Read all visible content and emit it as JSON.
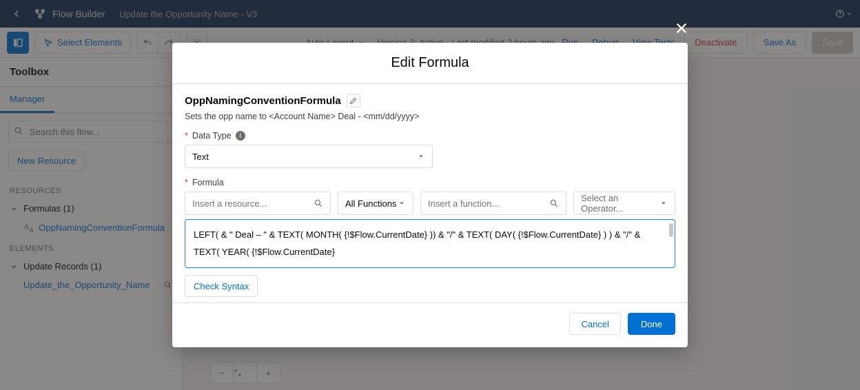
{
  "topbar": {
    "app_title": "Flow Builder",
    "page_name": "Update the Opportunity Name - V3"
  },
  "toolbar": {
    "select_elements": "Select Elements",
    "auto_layout": "Auto-Layout",
    "version_status": "Version 3: Active · Last modified 2 hours ago",
    "run": "Run",
    "debug": "Debug",
    "view_tests": "View Tests",
    "deactivate": "Deactivate",
    "save_as": "Save As",
    "save": "Save"
  },
  "sidebar": {
    "title": "Toolbox",
    "tab_manager": "Manager",
    "search_placeholder": "Search this flow...",
    "new_resource": "New Resource",
    "section_resources": "RESOURCES",
    "group_formulas": "Formulas (1)",
    "formula_item": "OppNamingConventionFormula",
    "section_elements": "ELEMENTS",
    "group_update_records": "Update Records (1)",
    "update_item": "Update_the_Opportunity_Name"
  },
  "modal": {
    "title": "Edit Formula",
    "formula_name": "OppNamingConventionFormula",
    "subtitle": "Sets the opp name to <Account Name> Deal - <mm/dd/yyyy>",
    "data_type_label": "Data Type",
    "data_type_value": "Text",
    "formula_label": "Formula",
    "resource_placeholder": "Insert a resource...",
    "functions_label": "All Functions",
    "function_placeholder": "Insert a function...",
    "operator_placeholder": "Select an Operator...",
    "formula_text": "LEFT(  & \" Deal – \" &\n\nTEXT( MONTH( {!$Flow.CurrentDate} )) & \"/\" & TEXT( DAY( {!$Flow.CurrentDate} ) ) & \"/\" & TEXT( YEAR( {!$Flow.CurrentDate}",
    "check_syntax": "Check Syntax",
    "cancel": "Cancel",
    "done": "Done"
  }
}
